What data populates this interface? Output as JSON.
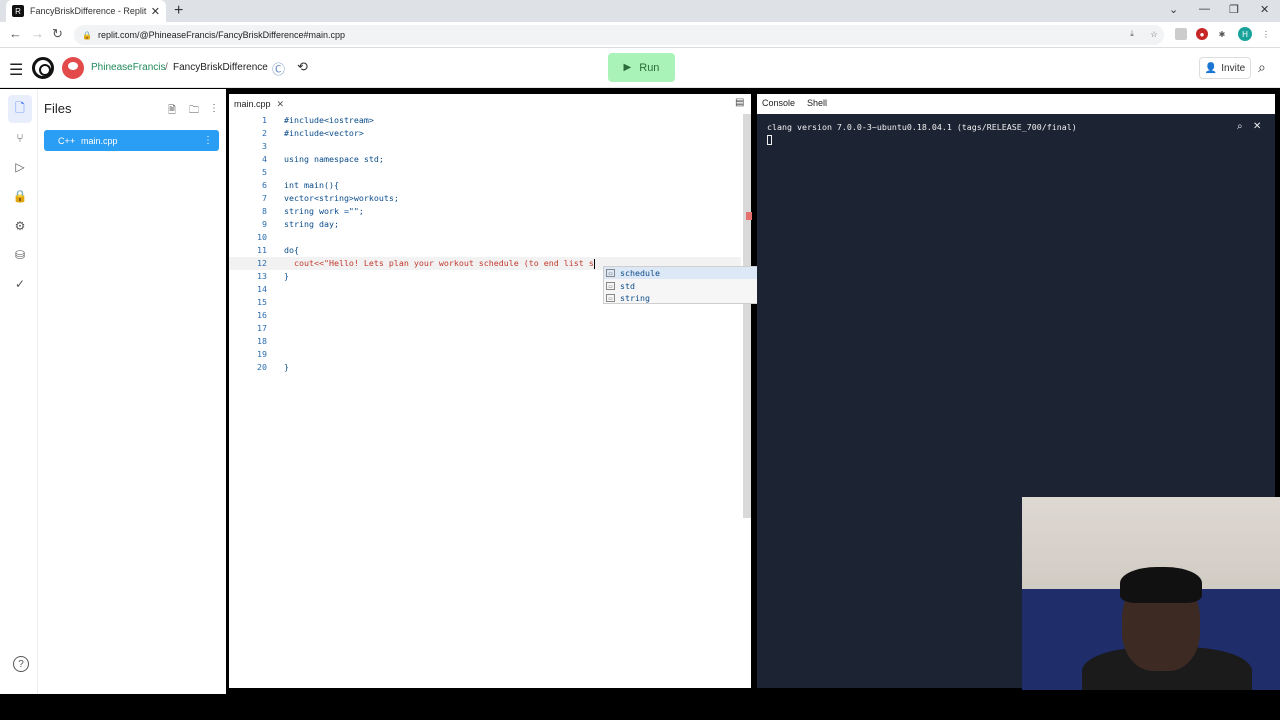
{
  "browser": {
    "tab_title": "FancyBriskDifference - Replit",
    "url": "replit.com/@PhineaseFrancis/FancyBriskDifference#main.cpp"
  },
  "header": {
    "username": "PhineaseFrancis",
    "separator": "/",
    "repl_name": "FancyBriskDifference",
    "run_label": "Run",
    "invite_label": "Invite"
  },
  "files_panel": {
    "title": "Files",
    "files": [
      {
        "name": "main.cpp"
      }
    ]
  },
  "editor": {
    "tab_label": "main.cpp",
    "lines": [
      {
        "num": "1",
        "text": "#include<iostream>"
      },
      {
        "num": "2",
        "text": "#include<vector>"
      },
      {
        "num": "3",
        "text": ""
      },
      {
        "num": "4",
        "text": "using namespace std;"
      },
      {
        "num": "5",
        "text": ""
      },
      {
        "num": "6",
        "text": "int main(){"
      },
      {
        "num": "7",
        "text": "vector<string>workouts;"
      },
      {
        "num": "8",
        "text": "string work =\"\";"
      },
      {
        "num": "9",
        "text": "string day;"
      },
      {
        "num": "10",
        "text": ""
      },
      {
        "num": "11",
        "text": "do{"
      },
      {
        "num": "12",
        "text": "  cout<<\"Hello! Lets plan your workout schedule (to end list s"
      },
      {
        "num": "13",
        "text": "}"
      },
      {
        "num": "14",
        "text": ""
      },
      {
        "num": "15",
        "text": ""
      },
      {
        "num": "16",
        "text": ""
      },
      {
        "num": "17",
        "text": ""
      },
      {
        "num": "18",
        "text": ""
      },
      {
        "num": "19",
        "text": ""
      },
      {
        "num": "20",
        "text": "}"
      }
    ],
    "autocomplete": [
      "schedule",
      "std",
      "string"
    ]
  },
  "console_panel": {
    "tabs": [
      "Console",
      "Shell"
    ],
    "output": "clang version 7.0.0-3~ubuntu0.18.04.1 (tags/RELEASE_700/final)"
  }
}
